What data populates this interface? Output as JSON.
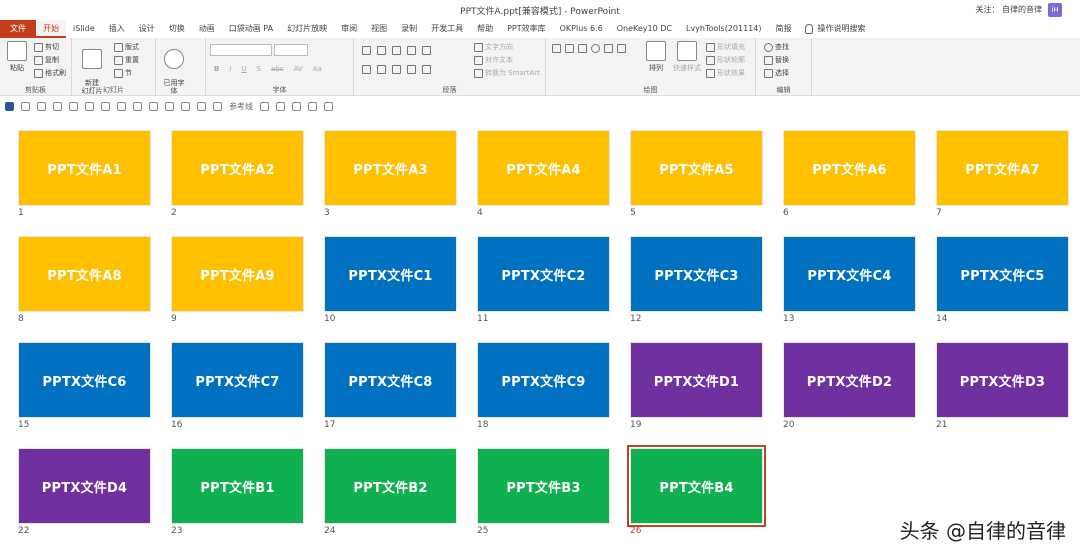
{
  "window": {
    "title": "PPT文件A.ppt[兼容模式]  -  PowerPoint",
    "follow_text": "关注：  自律的音律",
    "avatar": "iH"
  },
  "tabs": [
    {
      "label": "文件",
      "kind": "file"
    },
    {
      "label": "开始",
      "kind": "active"
    },
    {
      "label": "iSlide",
      "kind": ""
    },
    {
      "label": "插入",
      "kind": ""
    },
    {
      "label": "设计",
      "kind": ""
    },
    {
      "label": "切换",
      "kind": ""
    },
    {
      "label": "动画",
      "kind": ""
    },
    {
      "label": "口袋动画 PA",
      "kind": ""
    },
    {
      "label": "幻灯片放映",
      "kind": ""
    },
    {
      "label": "审阅",
      "kind": ""
    },
    {
      "label": "视图",
      "kind": ""
    },
    {
      "label": "录制",
      "kind": ""
    },
    {
      "label": "开发工具",
      "kind": ""
    },
    {
      "label": "帮助",
      "kind": ""
    },
    {
      "label": "PPT效率库",
      "kind": ""
    },
    {
      "label": "OKPlus 6.6",
      "kind": ""
    },
    {
      "label": "OneKey10 DC",
      "kind": ""
    },
    {
      "label": "LvyhTools(201114)",
      "kind": ""
    },
    {
      "label": "简报",
      "kind": ""
    },
    {
      "label": "操作说明搜索",
      "kind": "search"
    }
  ],
  "ribbon": {
    "clipboard": {
      "label": "剪贴板",
      "paste": "粘贴",
      "cut": "剪切",
      "copy": "复制",
      "format_painter": "格式刷"
    },
    "slides": {
      "label": "幻灯片",
      "new_slide": "新建\n幻灯片",
      "layout": "版式",
      "reset": "重置",
      "section": "节"
    },
    "font": {
      "label": "字体",
      "used_fonts": "已用字\n体",
      "bold": "B",
      "italic": "I",
      "underline": "U",
      "strike": "S",
      "abc": "abc",
      "spacing": "AV",
      "case": "Aa"
    },
    "paragraph": {
      "label": "段落",
      "text_direction": "文字方向",
      "align_text": "对齐文本",
      "smartart": "转换为 SmartArt"
    },
    "drawing": {
      "label": "绘图",
      "arrange": "排列",
      "quick_styles": "快速样式",
      "shape_fill": "形状填充",
      "shape_outline": "形状轮廓",
      "shape_effects": "形状效果"
    },
    "editing": {
      "label": "编辑",
      "find": "查找",
      "replace": "替换",
      "select": "选择"
    }
  },
  "qat": {
    "reference_line": "参考线"
  },
  "colors": {
    "yellow": "#ffc000",
    "blue": "#0070c0",
    "purple": "#7030a0",
    "green": "#10b050"
  },
  "slides": [
    {
      "num": "1",
      "text": "PPT文件A1",
      "color": "yellow"
    },
    {
      "num": "2",
      "text": "PPT文件A2",
      "color": "yellow"
    },
    {
      "num": "3",
      "text": "PPT文件A3",
      "color": "yellow"
    },
    {
      "num": "4",
      "text": "PPT文件A4",
      "color": "yellow"
    },
    {
      "num": "5",
      "text": "PPT文件A5",
      "color": "yellow"
    },
    {
      "num": "6",
      "text": "PPT文件A6",
      "color": "yellow"
    },
    {
      "num": "7",
      "text": "PPT文件A7",
      "color": "yellow"
    },
    {
      "num": "8",
      "text": "PPT文件A8",
      "color": "yellow"
    },
    {
      "num": "9",
      "text": "PPT文件A9",
      "color": "yellow"
    },
    {
      "num": "10",
      "text": "PPTX文件C1",
      "color": "blue"
    },
    {
      "num": "11",
      "text": "PPTX文件C2",
      "color": "blue"
    },
    {
      "num": "12",
      "text": "PPTX文件C3",
      "color": "blue"
    },
    {
      "num": "13",
      "text": "PPTX文件C4",
      "color": "blue"
    },
    {
      "num": "14",
      "text": "PPTX文件C5",
      "color": "blue"
    },
    {
      "num": "15",
      "text": "PPTX文件C6",
      "color": "blue"
    },
    {
      "num": "16",
      "text": "PPTX文件C7",
      "color": "blue"
    },
    {
      "num": "17",
      "text": "PPTX文件C8",
      "color": "blue"
    },
    {
      "num": "18",
      "text": "PPTX文件C9",
      "color": "blue"
    },
    {
      "num": "19",
      "text": "PPTX文件D1",
      "color": "purple"
    },
    {
      "num": "20",
      "text": "PPTX文件D2",
      "color": "purple"
    },
    {
      "num": "21",
      "text": "PPTX文件D3",
      "color": "purple"
    },
    {
      "num": "22",
      "text": "PPTX文件D4",
      "color": "purple"
    },
    {
      "num": "23",
      "text": "PPT文件B1",
      "color": "green"
    },
    {
      "num": "24",
      "text": "PPT文件B2",
      "color": "green"
    },
    {
      "num": "25",
      "text": "PPT文件B3",
      "color": "green"
    },
    {
      "num": "26",
      "text": "PPT文件B4",
      "color": "green",
      "selected": true
    }
  ],
  "watermark": "头条 @自律的音律"
}
